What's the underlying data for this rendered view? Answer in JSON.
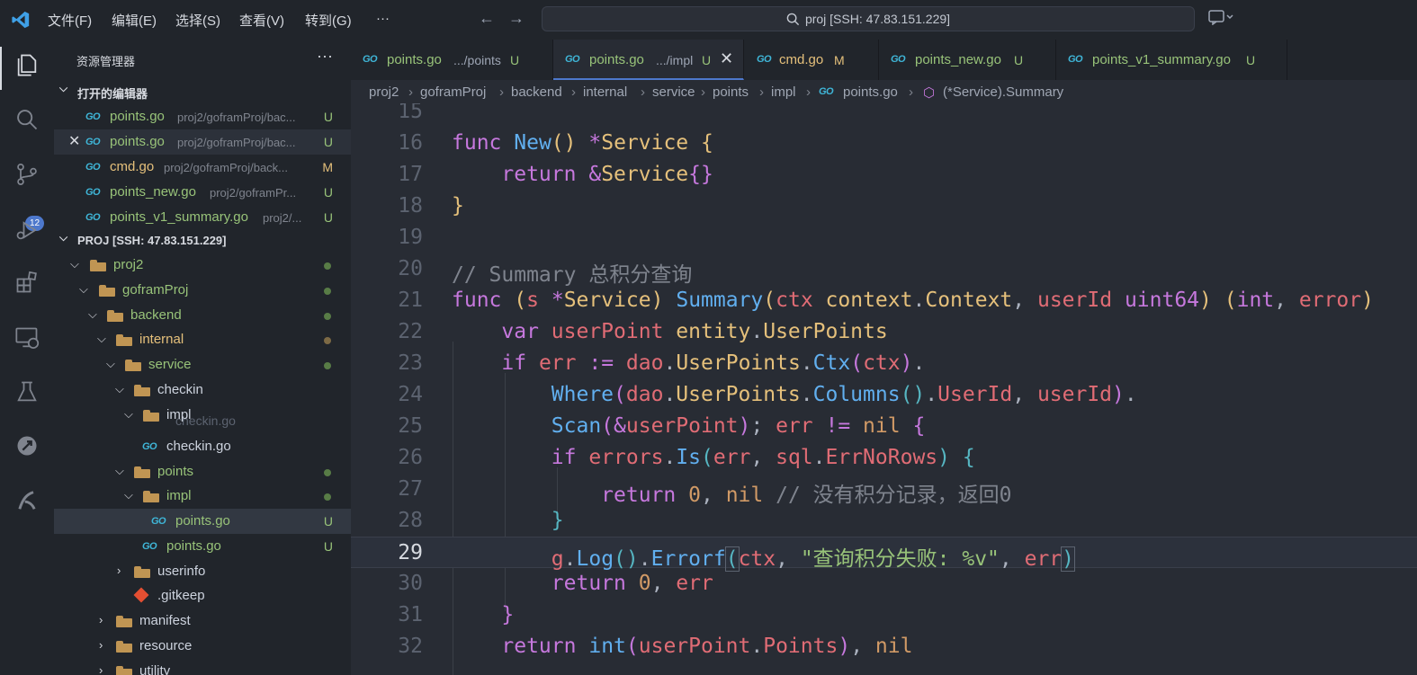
{
  "titlebar": {
    "menus": [
      "文件(F)",
      "编辑(E)",
      "选择(S)",
      "查看(V)",
      "转到(G)",
      "···"
    ],
    "search_text": "proj [SSH: 47.83.151.229]"
  },
  "activity": {
    "scm_badge": "12",
    "icons": [
      "explorer-icon",
      "search-icon",
      "source-control-icon",
      "run-debug-icon",
      "extensions-icon",
      "remote-explorer-icon",
      "testing-icon",
      "go-extension-icon",
      "project-icon"
    ]
  },
  "sidebar": {
    "title": "资源管理器",
    "more": "···",
    "open_editors_label": "打开的编辑器",
    "open_editors": [
      {
        "name": "points.go",
        "path": "proj2/goframProj/bac...",
        "status": "U"
      },
      {
        "name": "points.go",
        "path": "proj2/goframProj/bac...",
        "status": "U"
      },
      {
        "name": "cmd.go",
        "path": "proj2/goframProj/back...",
        "status": "M"
      },
      {
        "name": "points_new.go",
        "path": "proj2/goframPr...",
        "status": "U"
      },
      {
        "name": "points_v1_summary.go",
        "path": "proj2/...",
        "status": "U"
      }
    ],
    "project_label": "PROJ [SSH: 47.83.151.229]",
    "tree": {
      "proj2": "proj2",
      "goframProj": "goframProj",
      "backend": "backend",
      "internal": "internal",
      "service": "service",
      "checkin": "checkin",
      "checkin_impl": "impl",
      "checkin_overlap": "checkin.go",
      "checkin_go": "checkin.go",
      "points": "points",
      "points_impl": "impl",
      "points_impl_go": "points.go",
      "points_impl_status": "U",
      "points_go": "points.go",
      "points_go_status": "U",
      "userinfo": "userinfo",
      "gitkeep": ".gitkeep",
      "manifest": "manifest",
      "resource": "resource",
      "utility": "utility"
    }
  },
  "tabs": [
    {
      "icon": "GO",
      "label": "points.go",
      "desc": ".../points",
      "status": "U"
    },
    {
      "icon": "GO",
      "label": "points.go",
      "desc": ".../impl",
      "status": "U",
      "close": "✕"
    },
    {
      "icon": "GO",
      "label": "cmd.go",
      "status": "M"
    },
    {
      "icon": "GO",
      "label": "points_new.go",
      "status": "U"
    },
    {
      "icon": "GO",
      "label": "points_v1_summary.go",
      "status": "U"
    }
  ],
  "breadcrumb": [
    "proj2",
    "goframProj",
    "backend",
    "internal",
    "service",
    "points",
    "impl",
    "points.go",
    "(*Service).Summary"
  ],
  "editor": {
    "line_numbers": [
      "15",
      "16",
      "17",
      "18",
      "19",
      "20",
      "21",
      "22",
      "23",
      "24",
      "25",
      "26",
      "27",
      "28",
      "29",
      "30",
      "31",
      "32"
    ],
    "current_line": "29",
    "comment_summary": "// Summary 总积分查询",
    "comment_zero": "// 没有积分记录，返回0",
    "error_string": "\"查询积分失败: %v\""
  },
  "colors": {
    "background": "#282c34",
    "sidebar": "#21252b",
    "accent": "#4d78cc",
    "untracked": "#98c379",
    "modified": "#e5c07b"
  }
}
